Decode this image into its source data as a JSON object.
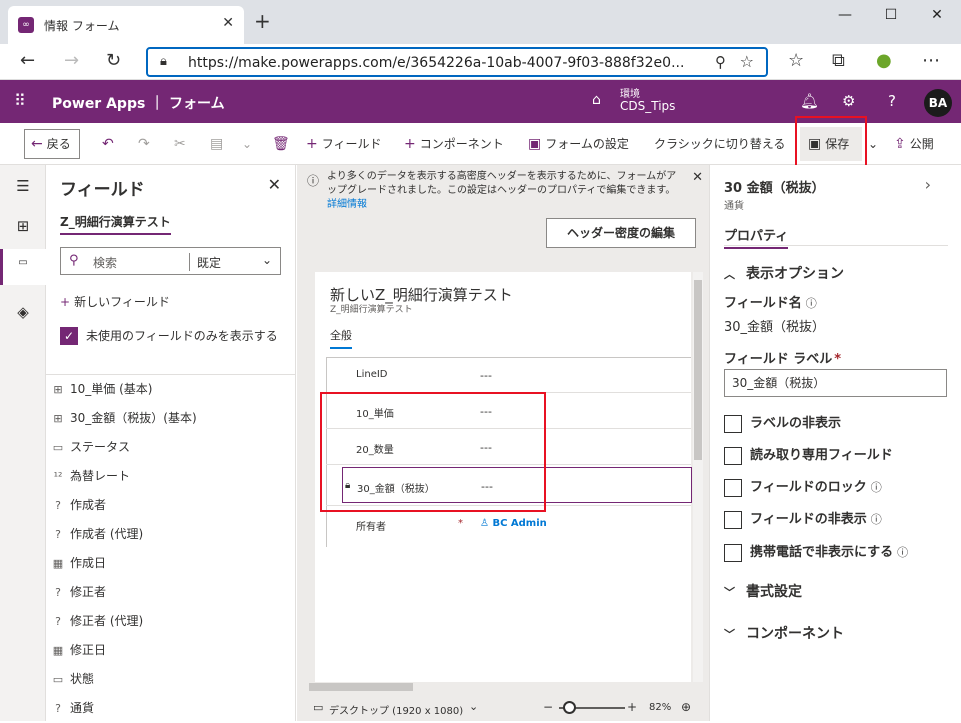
{
  "browser": {
    "tab_title": "情報 フォーム",
    "url": "https://make.powerapps.com/e/3654226a-10ab-4007-9f03-888f32e0..."
  },
  "app": {
    "title": "Power Apps ｜ フォーム",
    "environment_label": "環境",
    "environment_name": "CDS_Tips",
    "avatar": "BA"
  },
  "commands": {
    "back": "戻る",
    "field": "フィールド",
    "component": "コンポーネント",
    "form_settings": "フォームの設定",
    "classic": "クラシックに切り替える",
    "save": "保存",
    "publish": "公開"
  },
  "fields_panel": {
    "title": "フィールド",
    "entity": "Z_明細行演算テスト",
    "search_placeholder": "検索",
    "filter": "既定",
    "new_field": "新しいフィールド",
    "unused_only": "未使用のフィールドのみを表示する",
    "items": [
      {
        "icon": "number-icon",
        "glyph": "⊞",
        "label": "10_単価 (基本)"
      },
      {
        "icon": "number-icon",
        "glyph": "⊞",
        "label": "30_金額（税抜）(基本)"
      },
      {
        "icon": "option-set-icon",
        "glyph": "▭",
        "label": "ステータス"
      },
      {
        "icon": "decimal-icon",
        "glyph": "¹²",
        "label": "為替レート"
      },
      {
        "icon": "lookup-icon",
        "glyph": "?",
        "label": "作成者"
      },
      {
        "icon": "lookup-icon",
        "glyph": "?",
        "label": "作成者 (代理)"
      },
      {
        "icon": "date-icon",
        "glyph": "▦",
        "label": "作成日"
      },
      {
        "icon": "lookup-icon",
        "glyph": "?",
        "label": "修正者"
      },
      {
        "icon": "lookup-icon",
        "glyph": "?",
        "label": "修正者 (代理)"
      },
      {
        "icon": "date-icon",
        "glyph": "▦",
        "label": "修正日"
      },
      {
        "icon": "option-set-icon",
        "glyph": "▭",
        "label": "状態"
      },
      {
        "icon": "lookup-icon",
        "glyph": "?",
        "label": "通貨"
      }
    ]
  },
  "canvas": {
    "banner_text": "より多くのデータを表示する高密度ヘッダーを表示するために、フォームがアップグレードされました。この設定はヘッダーのプロパティで編集できます。",
    "banner_link": "詳細情報",
    "header_button": "ヘッダー密度の編集",
    "form_title": "新しいZ_明細行演算テスト",
    "form_subtitle": "Z_明細行演算テスト",
    "form_tab": "全般",
    "rows": [
      {
        "label": "LineID",
        "value": "---"
      },
      {
        "label": "10_単価",
        "value": "---"
      },
      {
        "label": "20_数量",
        "value": "---"
      },
      {
        "label": "30_金額（税抜）",
        "value": "---"
      },
      {
        "label": "所有者",
        "value": "BC Admin"
      }
    ],
    "status_view": "デスクトップ (1920 x 1080)",
    "zoom": "82%"
  },
  "properties": {
    "title": "30 金額（税抜）",
    "subtitle": "通貨",
    "tab": "プロパティ",
    "display_section": "表示オプション",
    "field_name_label": "フィールド名",
    "field_name_value": "30_金額（税抜）",
    "field_label_label": "フィールド ラベル",
    "field_label_value": "30_金額（税抜）",
    "checkboxes": [
      "ラベルの非表示",
      "読み取り専用フィールド",
      "フィールドのロック",
      "フィールドの非表示",
      "携帯電話で非表示にする"
    ],
    "format_section": "書式設定",
    "component_section": "コンポーネント"
  },
  "colors": {
    "brand": "#742774",
    "highlight": "#e81123"
  }
}
